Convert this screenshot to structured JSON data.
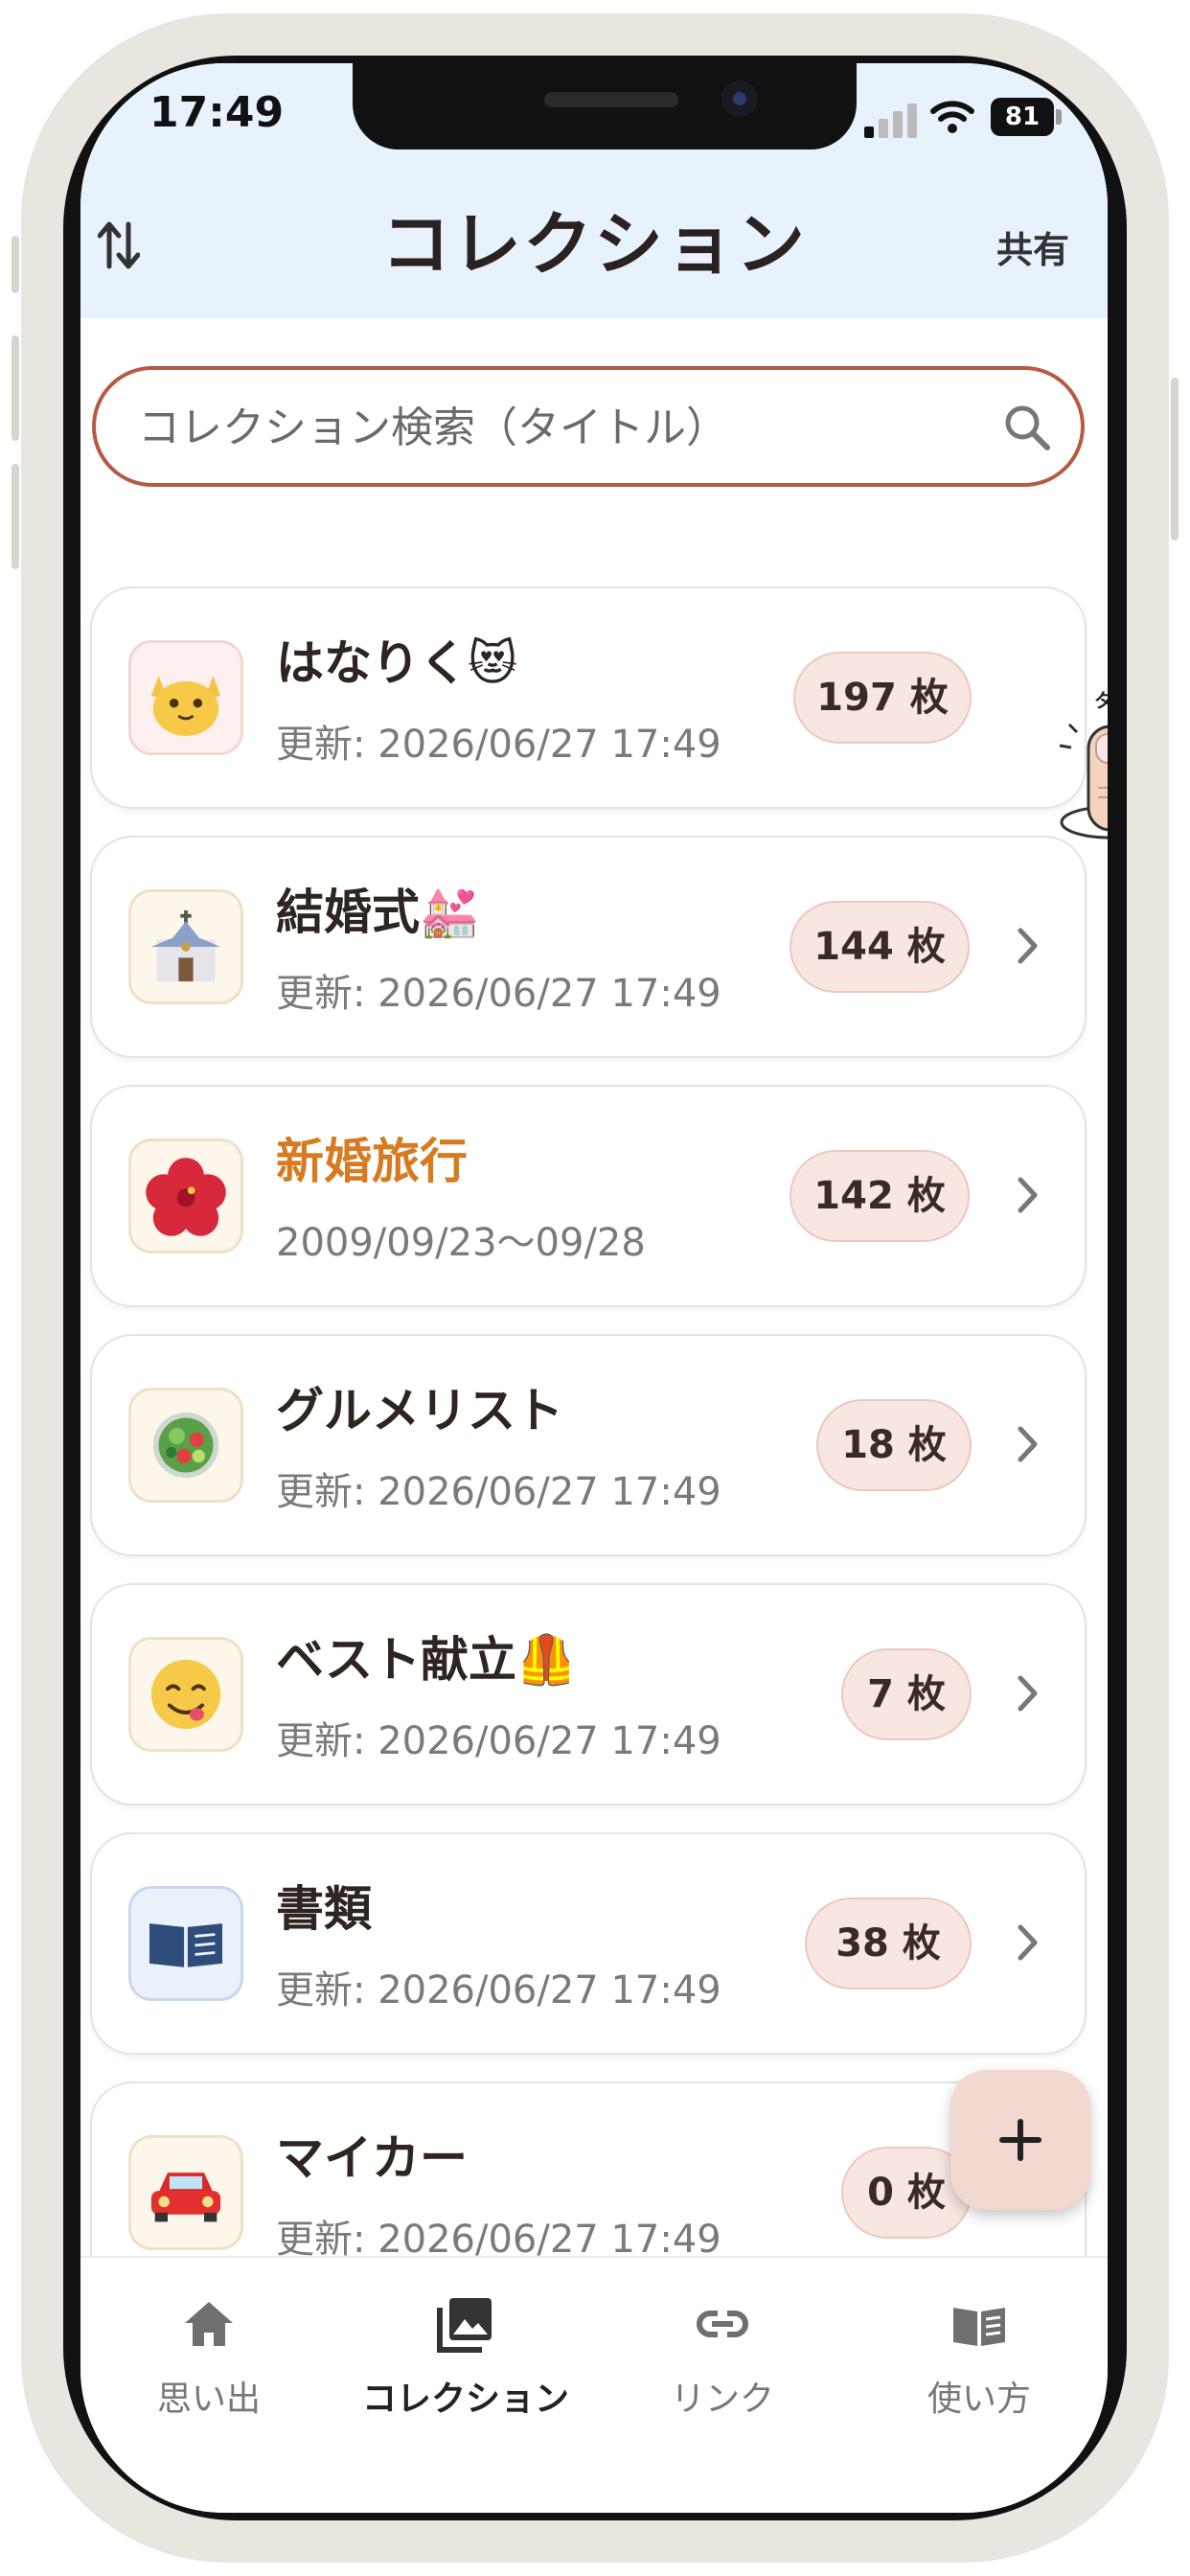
{
  "status_bar": {
    "time": "17:49",
    "battery": "81"
  },
  "header": {
    "title": "コレクション",
    "share_label": "共有"
  },
  "search": {
    "placeholder": "コレクション検索（タイトル）"
  },
  "collections": [
    {
      "name": "はなりく😻",
      "sub": "更新: 2026/06/27 17:49",
      "count": "197 枚",
      "icon": "cat-face-icon",
      "highlight": false
    },
    {
      "name": "結婚式💒",
      "sub": "更新: 2026/06/27 17:49",
      "count": "144 枚",
      "icon": "church-icon",
      "highlight": false
    },
    {
      "name": "新婚旅行",
      "sub": "2009/09/23〜09/28",
      "count": "142 枚",
      "icon": "hibiscus-icon",
      "highlight": true
    },
    {
      "name": "グルメリスト",
      "sub": "更新: 2026/06/27 17:49",
      "count": "18 枚",
      "icon": "salad-icon",
      "highlight": false
    },
    {
      "name": "ベスト献立🦺",
      "sub": "更新: 2026/06/27 17:49",
      "count": "7 枚",
      "icon": "yum-face-icon",
      "highlight": false
    },
    {
      "name": "書類",
      "sub": "更新: 2026/06/27 17:49",
      "count": "38 枚",
      "icon": "book-icon",
      "highlight": false
    },
    {
      "name": "マイカー",
      "sub": "更新: 2026/06/27 17:49",
      "count": "0 枚",
      "icon": "car-icon",
      "highlight": false
    }
  ],
  "tap_hint": {
    "label": "タップ"
  },
  "nav": [
    {
      "label": "思い出",
      "icon": "home-icon",
      "active": false
    },
    {
      "label": "コレクション",
      "icon": "photo-library-icon",
      "active": true
    },
    {
      "label": "リンク",
      "icon": "link-icon",
      "active": false
    },
    {
      "label": "使い方",
      "icon": "book-open-icon",
      "active": false
    }
  ],
  "colors": {
    "accent": "#b45b42",
    "header_bg": "#e8f2fd",
    "badge_bg": "#f7e6e2",
    "highlight_text": "#d77a20"
  }
}
